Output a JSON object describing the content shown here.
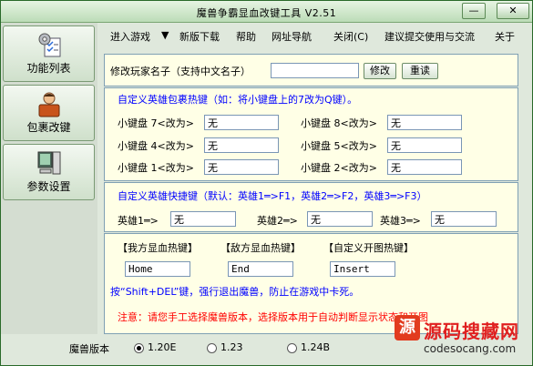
{
  "window": {
    "title": "魔兽争霸显血改键工具 V2.51",
    "minimize": "—",
    "close": "✕"
  },
  "sidebar": {
    "items": [
      {
        "label": "功能列表",
        "icon": "settings-checklist-icon"
      },
      {
        "label": "包裹改键",
        "icon": "user-bag-icon"
      },
      {
        "label": "参数设置",
        "icon": "computer-icon"
      }
    ]
  },
  "menu": {
    "items": [
      "进入游戏",
      "▼",
      "新版下载",
      "帮助",
      "网址导航",
      "关闭(C)",
      "建议提交使用与交流",
      "关于"
    ]
  },
  "rename": {
    "label": "修改玩家名子（支持中文名子）",
    "value": "",
    "modify_button": "修改",
    "reset_button": "重读"
  },
  "inventory": {
    "title": "自定义英雄包裹热键（如：将小键盘上的7改为Q键）。",
    "keys": [
      {
        "label": "小键盘 7<改为>",
        "value": "无"
      },
      {
        "label": "小键盘 8<改为>",
        "value": "无"
      },
      {
        "label": "小键盘 4<改为>",
        "value": "无"
      },
      {
        "label": "小键盘 5<改为>",
        "value": "无"
      },
      {
        "label": "小键盘 1<改为>",
        "value": "无"
      },
      {
        "label": "小键盘 2<改为>",
        "value": "无"
      }
    ]
  },
  "hero": {
    "title": "自定义英雄快捷键（默认：英雄1═>F1，英雄2═>F2，英雄3═>F3）",
    "keys": [
      {
        "label": "英雄1═>",
        "value": "无"
      },
      {
        "label": "英雄2═>",
        "value": "无"
      },
      {
        "label": "英雄3═>",
        "value": "无"
      }
    ]
  },
  "hotkeys": {
    "own_label": "【我方显血热键】",
    "enemy_label": "【敌方显血热键】",
    "map_label": "【自定义开图热键】",
    "own_value": "Home",
    "enemy_value": "End",
    "map_value": "Insert",
    "shift_del_note": "按“Shift+DEL”键，强行退出魔兽，防止在游戏中卡死。",
    "warning": "注意：请您手工选择魔兽版本，选择版本用于自动判断显示状态和开图"
  },
  "version": {
    "label": "魔兽版本",
    "options": [
      "1.20E",
      "1.23",
      "1.24B"
    ],
    "selected": "1.20E"
  },
  "watermark": {
    "brand": "源码搜藏网",
    "url": "codesocang.com"
  },
  "colors": {
    "accent_green": "#0a7a0a",
    "panel_bg": "#ffffe6",
    "link_blue": "#0000ff",
    "warning_red": "#ff0000"
  }
}
